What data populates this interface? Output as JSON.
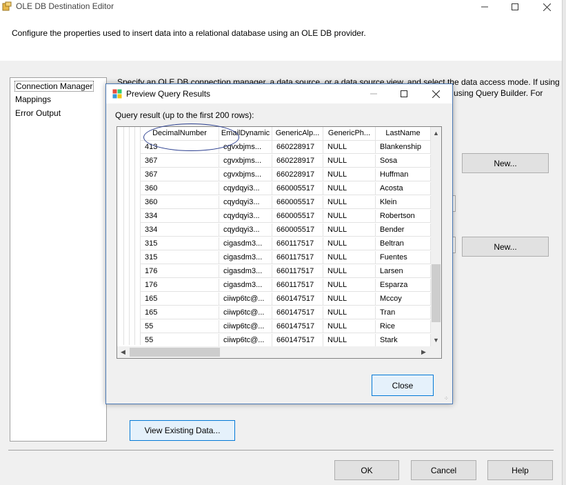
{
  "window": {
    "title": "OLE DB Destination Editor",
    "minimize": "—",
    "maximize": "☐",
    "close": "✕"
  },
  "banner": {
    "text": "Configure the properties used to insert data into a relational database using an OLE DB provider."
  },
  "nav": {
    "items": [
      {
        "label": "Connection Manager",
        "selected": true
      },
      {
        "label": "Mappings",
        "selected": false
      },
      {
        "label": "Error Output",
        "selected": false
      }
    ]
  },
  "content": {
    "desc_line_1": "Specify an OLE DB connection manager, a data source, or a data source view, and select the data access mode. If using",
    "desc_line_2": "using Query Builder. For",
    "new_button_1": "New...",
    "new_button_2": "New...",
    "view_existing": "View Existing Data..."
  },
  "footer": {
    "ok": "OK",
    "cancel": "Cancel",
    "help": "Help"
  },
  "dialog": {
    "title": "Preview Query Results",
    "minimize": "—",
    "maximize": "☐",
    "close": "✕",
    "query_label": "Query result (up to the first 200 rows):",
    "close_button": "Close",
    "grid": {
      "columns": [
        "DecimalNumber",
        "EmailDynamic",
        "GenericAlp...",
        "GenericPh...",
        "LastName"
      ],
      "rows": [
        [
          "413",
          "cgvxbjms...",
          "660228917",
          "NULL",
          "Blankenship"
        ],
        [
          "367",
          "cgvxbjms...",
          "660228917",
          "NULL",
          "Sosa"
        ],
        [
          "367",
          "cgvxbjms...",
          "660228917",
          "NULL",
          "Huffman"
        ],
        [
          "360",
          "cqydqyi3...",
          "660005517",
          "NULL",
          "Acosta"
        ],
        [
          "360",
          "cqydqyi3...",
          "660005517",
          "NULL",
          "Klein"
        ],
        [
          "334",
          "cqydqyi3...",
          "660005517",
          "NULL",
          "Robertson"
        ],
        [
          "334",
          "cqydqyi3...",
          "660005517",
          "NULL",
          "Bender"
        ],
        [
          "315",
          "cigasdm3...",
          "660117517",
          "NULL",
          "Beltran"
        ],
        [
          "315",
          "cigasdm3...",
          "660117517",
          "NULL",
          "Fuentes"
        ],
        [
          "176",
          "cigasdm3...",
          "660117517",
          "NULL",
          "Larsen"
        ],
        [
          "176",
          "cigasdm3...",
          "660117517",
          "NULL",
          "Esparza"
        ],
        [
          "165",
          "ciiwp6tc@...",
          "660147517",
          "NULL",
          "Mccoy"
        ],
        [
          "165",
          "ciiwp6tc@...",
          "660147517",
          "NULL",
          "Tran"
        ],
        [
          "55",
          "ciiwp6tc@...",
          "660147517",
          "NULL",
          "Rice"
        ],
        [
          "55",
          "ciiwp6tc@...",
          "660147517",
          "NULL",
          "Stark"
        ]
      ]
    }
  },
  "colors": {
    "accent": "#0078d7",
    "annotation": "#2b3f8f"
  }
}
